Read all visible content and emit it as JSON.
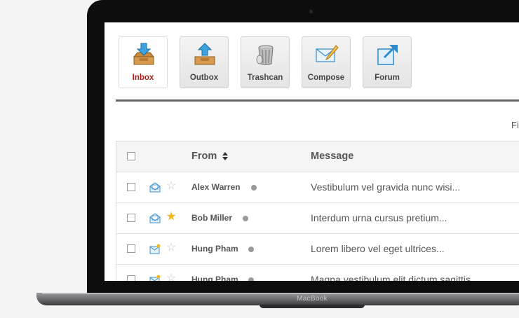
{
  "device": {
    "brand": "MacBook"
  },
  "toolbar": [
    {
      "label": "Inbox",
      "icon": "inbox-download-icon",
      "active": true
    },
    {
      "label": "Outbox",
      "icon": "outbox-upload-icon",
      "active": false
    },
    {
      "label": "Trashcan",
      "icon": "trashcan-icon",
      "active": false
    },
    {
      "label": "Compose",
      "icon": "compose-envelope-icon",
      "active": false
    },
    {
      "label": "Forum",
      "icon": "forum-external-icon",
      "active": false
    }
  ],
  "filter_label_partial": "Fi",
  "table": {
    "headers": {
      "from": "From",
      "message": "Message"
    },
    "rows": [
      {
        "from": "Alex Warren",
        "message": "Vestibulum vel gravida nunc wisi...",
        "starred": false,
        "icon": "read-mail-icon"
      },
      {
        "from": "Bob Miller",
        "message": "Interdum urna cursus pretium...",
        "starred": true,
        "icon": "read-mail-icon"
      },
      {
        "from": "Hung Pham",
        "message": "Lorem libero vel eget ultrices...",
        "starred": false,
        "icon": "new-mail-icon"
      },
      {
        "from": "Hung Pham",
        "message": "Magna vestibulum elit dictum sagittis...",
        "starred": false,
        "icon": "new-mail-icon"
      }
    ]
  },
  "colors": {
    "active_label": "#b01c1c",
    "star_on": "#f3b91c",
    "star_off": "#c2c2c2"
  }
}
